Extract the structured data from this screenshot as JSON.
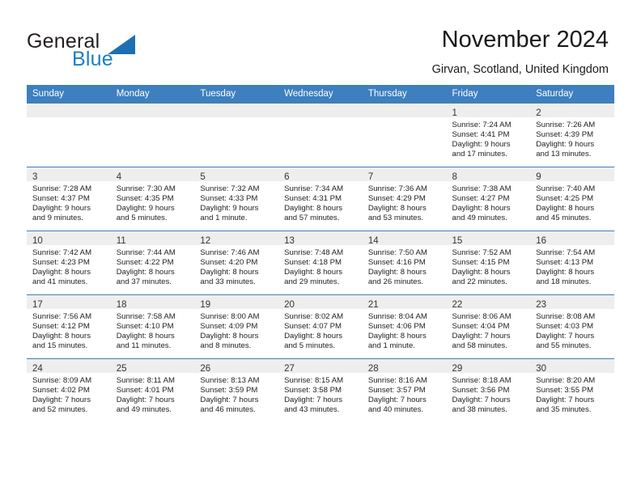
{
  "brand": {
    "name_part1": "General",
    "name_part2": "Blue",
    "triangle_color": "#1c6fb4",
    "blue_color": "#1a7fc4"
  },
  "header": {
    "title": "November 2024",
    "subtitle": "Girvan, Scotland, United Kingdom",
    "header_bg_color": "#3d7fbf"
  },
  "calendar": {
    "weekday_headers": [
      "Sunday",
      "Monday",
      "Tuesday",
      "Wednesday",
      "Thursday",
      "Friday",
      "Saturday"
    ],
    "weeks": [
      [
        {
          "day": "",
          "empty": true
        },
        {
          "day": "",
          "empty": true
        },
        {
          "day": "",
          "empty": true
        },
        {
          "day": "",
          "empty": true
        },
        {
          "day": "",
          "empty": true
        },
        {
          "day": "1",
          "sunrise": "Sunrise: 7:24 AM",
          "sunset": "Sunset: 4:41 PM",
          "daylight1": "Daylight: 9 hours",
          "daylight2": "and 17 minutes."
        },
        {
          "day": "2",
          "sunrise": "Sunrise: 7:26 AM",
          "sunset": "Sunset: 4:39 PM",
          "daylight1": "Daylight: 9 hours",
          "daylight2": "and 13 minutes."
        }
      ],
      [
        {
          "day": "3",
          "sunrise": "Sunrise: 7:28 AM",
          "sunset": "Sunset: 4:37 PM",
          "daylight1": "Daylight: 9 hours",
          "daylight2": "and 9 minutes."
        },
        {
          "day": "4",
          "sunrise": "Sunrise: 7:30 AM",
          "sunset": "Sunset: 4:35 PM",
          "daylight1": "Daylight: 9 hours",
          "daylight2": "and 5 minutes."
        },
        {
          "day": "5",
          "sunrise": "Sunrise: 7:32 AM",
          "sunset": "Sunset: 4:33 PM",
          "daylight1": "Daylight: 9 hours",
          "daylight2": "and 1 minute."
        },
        {
          "day": "6",
          "sunrise": "Sunrise: 7:34 AM",
          "sunset": "Sunset: 4:31 PM",
          "daylight1": "Daylight: 8 hours",
          "daylight2": "and 57 minutes."
        },
        {
          "day": "7",
          "sunrise": "Sunrise: 7:36 AM",
          "sunset": "Sunset: 4:29 PM",
          "daylight1": "Daylight: 8 hours",
          "daylight2": "and 53 minutes."
        },
        {
          "day": "8",
          "sunrise": "Sunrise: 7:38 AM",
          "sunset": "Sunset: 4:27 PM",
          "daylight1": "Daylight: 8 hours",
          "daylight2": "and 49 minutes."
        },
        {
          "day": "9",
          "sunrise": "Sunrise: 7:40 AM",
          "sunset": "Sunset: 4:25 PM",
          "daylight1": "Daylight: 8 hours",
          "daylight2": "and 45 minutes."
        }
      ],
      [
        {
          "day": "10",
          "sunrise": "Sunrise: 7:42 AM",
          "sunset": "Sunset: 4:23 PM",
          "daylight1": "Daylight: 8 hours",
          "daylight2": "and 41 minutes."
        },
        {
          "day": "11",
          "sunrise": "Sunrise: 7:44 AM",
          "sunset": "Sunset: 4:22 PM",
          "daylight1": "Daylight: 8 hours",
          "daylight2": "and 37 minutes."
        },
        {
          "day": "12",
          "sunrise": "Sunrise: 7:46 AM",
          "sunset": "Sunset: 4:20 PM",
          "daylight1": "Daylight: 8 hours",
          "daylight2": "and 33 minutes."
        },
        {
          "day": "13",
          "sunrise": "Sunrise: 7:48 AM",
          "sunset": "Sunset: 4:18 PM",
          "daylight1": "Daylight: 8 hours",
          "daylight2": "and 29 minutes."
        },
        {
          "day": "14",
          "sunrise": "Sunrise: 7:50 AM",
          "sunset": "Sunset: 4:16 PM",
          "daylight1": "Daylight: 8 hours",
          "daylight2": "and 26 minutes."
        },
        {
          "day": "15",
          "sunrise": "Sunrise: 7:52 AM",
          "sunset": "Sunset: 4:15 PM",
          "daylight1": "Daylight: 8 hours",
          "daylight2": "and 22 minutes."
        },
        {
          "day": "16",
          "sunrise": "Sunrise: 7:54 AM",
          "sunset": "Sunset: 4:13 PM",
          "daylight1": "Daylight: 8 hours",
          "daylight2": "and 18 minutes."
        }
      ],
      [
        {
          "day": "17",
          "sunrise": "Sunrise: 7:56 AM",
          "sunset": "Sunset: 4:12 PM",
          "daylight1": "Daylight: 8 hours",
          "daylight2": "and 15 minutes."
        },
        {
          "day": "18",
          "sunrise": "Sunrise: 7:58 AM",
          "sunset": "Sunset: 4:10 PM",
          "daylight1": "Daylight: 8 hours",
          "daylight2": "and 11 minutes."
        },
        {
          "day": "19",
          "sunrise": "Sunrise: 8:00 AM",
          "sunset": "Sunset: 4:09 PM",
          "daylight1": "Daylight: 8 hours",
          "daylight2": "and 8 minutes."
        },
        {
          "day": "20",
          "sunrise": "Sunrise: 8:02 AM",
          "sunset": "Sunset: 4:07 PM",
          "daylight1": "Daylight: 8 hours",
          "daylight2": "and 5 minutes."
        },
        {
          "day": "21",
          "sunrise": "Sunrise: 8:04 AM",
          "sunset": "Sunset: 4:06 PM",
          "daylight1": "Daylight: 8 hours",
          "daylight2": "and 1 minute."
        },
        {
          "day": "22",
          "sunrise": "Sunrise: 8:06 AM",
          "sunset": "Sunset: 4:04 PM",
          "daylight1": "Daylight: 7 hours",
          "daylight2": "and 58 minutes."
        },
        {
          "day": "23",
          "sunrise": "Sunrise: 8:08 AM",
          "sunset": "Sunset: 4:03 PM",
          "daylight1": "Daylight: 7 hours",
          "daylight2": "and 55 minutes."
        }
      ],
      [
        {
          "day": "24",
          "sunrise": "Sunrise: 8:09 AM",
          "sunset": "Sunset: 4:02 PM",
          "daylight1": "Daylight: 7 hours",
          "daylight2": "and 52 minutes."
        },
        {
          "day": "25",
          "sunrise": "Sunrise: 8:11 AM",
          "sunset": "Sunset: 4:01 PM",
          "daylight1": "Daylight: 7 hours",
          "daylight2": "and 49 minutes."
        },
        {
          "day": "26",
          "sunrise": "Sunrise: 8:13 AM",
          "sunset": "Sunset: 3:59 PM",
          "daylight1": "Daylight: 7 hours",
          "daylight2": "and 46 minutes."
        },
        {
          "day": "27",
          "sunrise": "Sunrise: 8:15 AM",
          "sunset": "Sunset: 3:58 PM",
          "daylight1": "Daylight: 7 hours",
          "daylight2": "and 43 minutes."
        },
        {
          "day": "28",
          "sunrise": "Sunrise: 8:16 AM",
          "sunset": "Sunset: 3:57 PM",
          "daylight1": "Daylight: 7 hours",
          "daylight2": "and 40 minutes."
        },
        {
          "day": "29",
          "sunrise": "Sunrise: 8:18 AM",
          "sunset": "Sunset: 3:56 PM",
          "daylight1": "Daylight: 7 hours",
          "daylight2": "and 38 minutes."
        },
        {
          "day": "30",
          "sunrise": "Sunrise: 8:20 AM",
          "sunset": "Sunset: 3:55 PM",
          "daylight1": "Daylight: 7 hours",
          "daylight2": "and 35 minutes."
        }
      ]
    ]
  }
}
